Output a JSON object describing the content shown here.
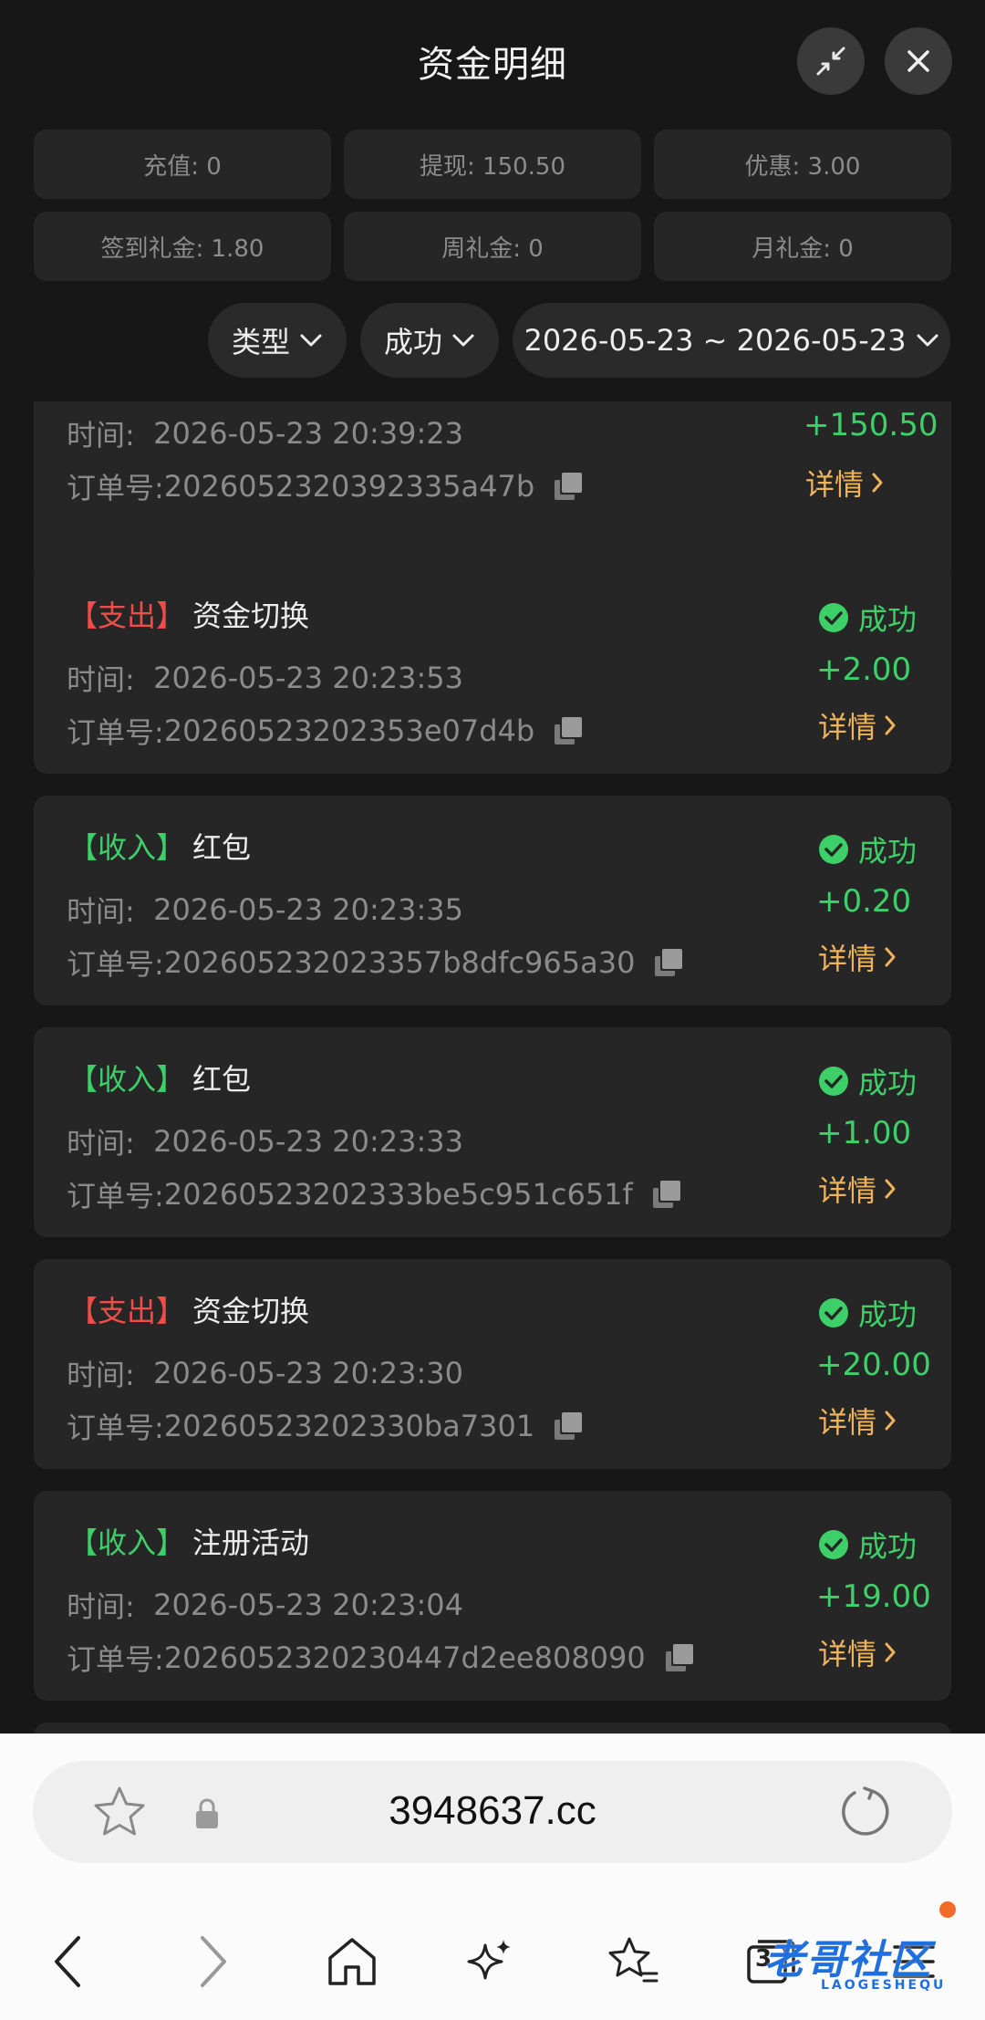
{
  "header": {
    "title": "资金明细"
  },
  "stats": [
    {
      "label": "充值: 0"
    },
    {
      "label": "提现: 150.50"
    },
    {
      "label": "优惠: 3.00"
    },
    {
      "label": "签到礼金: 1.80"
    },
    {
      "label": "周礼金: 0"
    },
    {
      "label": "月礼金: 0"
    }
  ],
  "filters": {
    "type": "类型",
    "status": "成功",
    "date_range": "2026-05-23 ~ 2026-05-23"
  },
  "labels": {
    "time": "时间:",
    "order": "订单号:",
    "detail": "详情"
  },
  "transactions": [
    {
      "tag": "",
      "name": "",
      "status": "",
      "time": "2026-05-23 20:39:23",
      "order_no": "2026052320392335a47b",
      "amount": "+150.50"
    },
    {
      "tag": "【支出】",
      "name": "资金切换",
      "status": "成功",
      "time": "2026-05-23 20:23:53",
      "order_no": "20260523202353e07d4b",
      "amount": "+2.00"
    },
    {
      "tag": "【收入】",
      "name": "红包",
      "status": "成功",
      "time": "2026-05-23 20:23:35",
      "order_no": "202605232023357b8dfc965a30",
      "amount": "+0.20"
    },
    {
      "tag": "【收入】",
      "name": "红包",
      "status": "成功",
      "time": "2026-05-23 20:23:33",
      "order_no": "20260523202333be5c951c651f",
      "amount": "+1.00"
    },
    {
      "tag": "【支出】",
      "name": "资金切换",
      "status": "成功",
      "time": "2026-05-23 20:23:30",
      "order_no": "20260523202330ba7301",
      "amount": "+20.00"
    },
    {
      "tag": "【收入】",
      "name": "注册活动",
      "status": "成功",
      "time": "2026-05-23 20:23:04",
      "order_no": "2026052320230447d2ee808090",
      "amount": "+19.00"
    }
  ],
  "browser": {
    "url": "3948637.cc",
    "tab_count": "3"
  },
  "watermark": {
    "text": "老哥社区",
    "sub": "LAOGESHEQU"
  },
  "colors": {
    "background": "#171717",
    "card": "#262626",
    "income": "#3dd068",
    "expense": "#ef4d48",
    "detail_link": "#f0b35a"
  }
}
